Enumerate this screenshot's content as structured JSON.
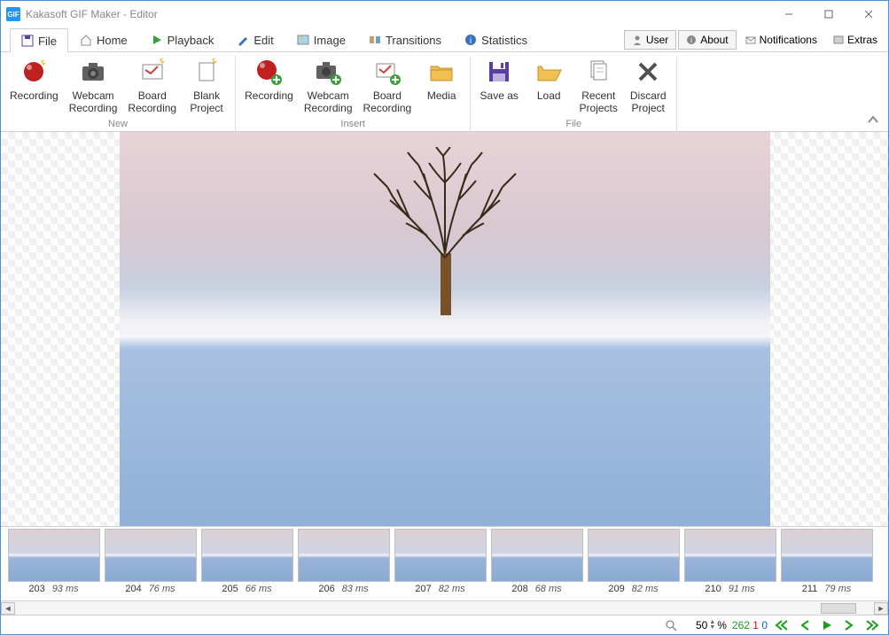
{
  "window": {
    "title": "Kakasoft GIF Maker - Editor",
    "logo": "GIF"
  },
  "tabs": {
    "file": "File",
    "home": "Home",
    "playback": "Playback",
    "edit": "Edit",
    "image": "Image",
    "transitions": "Transitions",
    "statistics": "Statistics"
  },
  "topright": {
    "user": "User",
    "about": "About",
    "notifications": "Notifications",
    "extras": "Extras"
  },
  "ribbon": {
    "new": {
      "label": "New",
      "recording": "Recording",
      "webcam": "Webcam\nRecording",
      "board": "Board\nRecording",
      "blank": "Blank\nProject"
    },
    "insert": {
      "label": "Insert",
      "recording": "Recording",
      "webcam": "Webcam\nRecording",
      "board": "Board\nRecording",
      "media": "Media"
    },
    "file": {
      "label": "File",
      "saveas": "Save as",
      "load": "Load",
      "recent": "Recent\nProjects",
      "discard": "Discard\nProject"
    }
  },
  "frames": [
    {
      "n": "203",
      "ms": "93 ms"
    },
    {
      "n": "204",
      "ms": "76 ms"
    },
    {
      "n": "205",
      "ms": "66 ms"
    },
    {
      "n": "206",
      "ms": "83 ms"
    },
    {
      "n": "207",
      "ms": "82 ms"
    },
    {
      "n": "208",
      "ms": "68 ms"
    },
    {
      "n": "209",
      "ms": "82 ms"
    },
    {
      "n": "210",
      "ms": "91 ms"
    },
    {
      "n": "211",
      "ms": "79 ms"
    }
  ],
  "status": {
    "zoom": "50",
    "pct": "%",
    "total": "262",
    "sel": "1",
    "cur": "0"
  }
}
